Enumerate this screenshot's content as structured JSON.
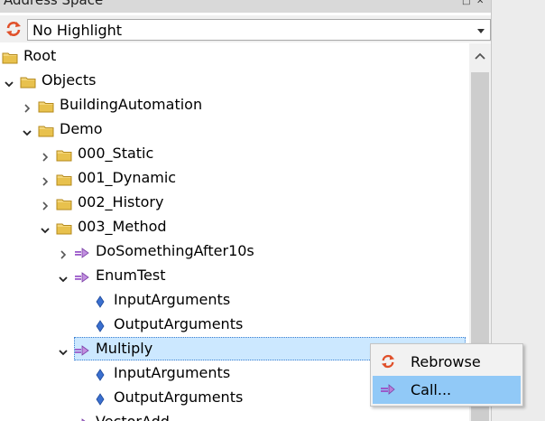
{
  "panel": {
    "title": "Address Space"
  },
  "toolbar": {
    "highlight_value": "No Highlight"
  },
  "tree": [
    {
      "label": "Root",
      "expander": "none",
      "icon": "folder-icon"
    },
    {
      "label": "Objects",
      "expander": "expanded",
      "icon": "folder-icon"
    },
    {
      "label": "BuildingAutomation",
      "expander": "collapsed",
      "icon": "folder-icon"
    },
    {
      "label": "Demo",
      "expander": "expanded",
      "icon": "folder-icon"
    },
    {
      "label": "000_Static",
      "expander": "collapsed",
      "icon": "folder-icon"
    },
    {
      "label": "001_Dynamic",
      "expander": "collapsed",
      "icon": "folder-icon"
    },
    {
      "label": "002_History",
      "expander": "collapsed",
      "icon": "folder-icon"
    },
    {
      "label": "003_Method",
      "expander": "expanded",
      "icon": "folder-icon"
    },
    {
      "label": "DoSomethingAfter10s",
      "expander": "collapsed",
      "icon": "method-icon"
    },
    {
      "label": "EnumTest",
      "expander": "expanded",
      "icon": "method-icon"
    },
    {
      "label": "InputArguments",
      "expander": "none",
      "icon": "property-icon"
    },
    {
      "label": "OutputArguments",
      "expander": "none",
      "icon": "property-icon"
    },
    {
      "label": "Multiply",
      "expander": "expanded",
      "icon": "method-icon",
      "selected": true
    },
    {
      "label": "InputArguments",
      "expander": "none",
      "icon": "property-icon"
    },
    {
      "label": "OutputArguments",
      "expander": "none",
      "icon": "property-icon"
    },
    {
      "label": "VectorAdd",
      "expander": "collapsed",
      "icon": "method-icon"
    }
  ],
  "context_menu": {
    "items": [
      {
        "label": "Rebrowse",
        "icon": "refresh-icon"
      },
      {
        "label": "Call...",
        "icon": "method-icon",
        "highlighted": true
      }
    ]
  },
  "colors": {
    "folder": "#e8c14d",
    "method": "#b77fd6",
    "property": "#3a6fcf",
    "refresh": "#e0502a",
    "selection": "#cce8ff",
    "menu_highlight": "#91c9f7"
  }
}
